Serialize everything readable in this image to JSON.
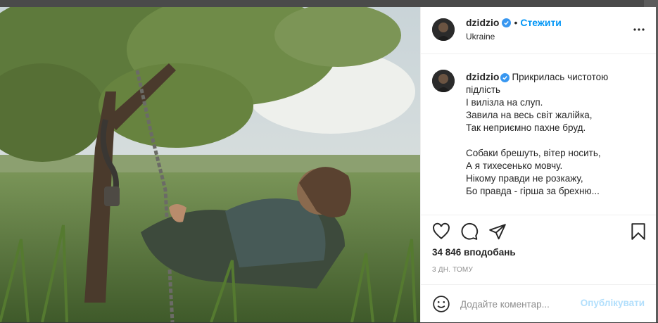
{
  "post": {
    "username": "dzidzio",
    "verified": true,
    "follow_label": "Стежити",
    "separator": "•",
    "location": "Ukraine",
    "caption_lines": [
      "Прикрилась чистотою",
      "підлість",
      "І вилізла на слуп.",
      "Завила на весь світ жалійка,",
      "Так неприємно пахне бруд.",
      "Собаки брешуть, вітер носить,",
      "А я тихесенько мовчу.",
      "Нікому правди не розкажу,",
      "Бо правда - гірша за брехню..."
    ],
    "likes": "34 846 вподобань",
    "time_ago": "3 дн. тому"
  },
  "comment": {
    "placeholder": "Додайте коментар...",
    "publish_label": "Опублікувати"
  },
  "icons": {
    "more": "more-options-icon",
    "like": "heart-icon",
    "comment": "comment-icon",
    "share": "share-icon",
    "save": "bookmark-icon",
    "emoji": "emoji-icon",
    "verified": "verified-badge-icon"
  },
  "colors": {
    "accent": "#0095f6",
    "publish_disabled": "#b2dffc",
    "verified": "#3897f0",
    "text": "#262626",
    "muted": "#8e8e8e"
  }
}
